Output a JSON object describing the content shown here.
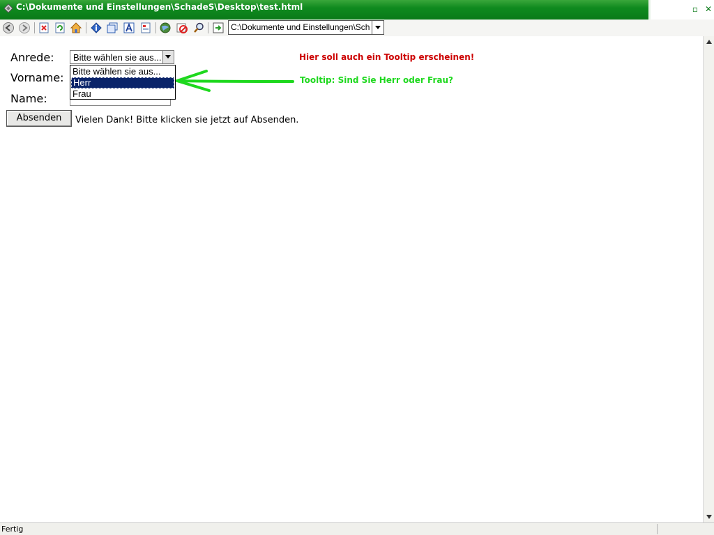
{
  "window": {
    "title": "C:\\Dokumente und Einstellungen\\SchadeS\\Desktop\\test.html",
    "minimize_glyph": "▫",
    "close_glyph": "✕"
  },
  "toolbar": {
    "icons": [
      "back-icon",
      "forward-icon",
      "stop-icon",
      "refresh-icon",
      "home-icon",
      "info-icon",
      "windows-icon",
      "font-icon",
      "page-icon",
      "globe-icon",
      "block-icon",
      "search-icon",
      "go-icon"
    ],
    "address_value": "C:\\Dokumente und Einstellungen\\Schade"
  },
  "form": {
    "anrede_label": "Anrede:",
    "vorname_label": "Vorname:",
    "name_label": "Name:",
    "select_value": "Bitte wählen sie aus...",
    "options": [
      "Bitte wählen sie aus...",
      "Herr",
      "Frau"
    ],
    "highlighted_option": "Herr",
    "submit_label": "Absenden",
    "thanks_text": "Vielen Dank! Bitte klicken sie jetzt auf Absenden."
  },
  "annotations": {
    "red_note": "Hier soll auch ein Tooltip erscheinen!",
    "green_note": "Tooltip: Sind Sie Herr oder Frau?",
    "red_color": "#cc0000",
    "green_color": "#1ed81e"
  },
  "status": {
    "text": "Fertig"
  }
}
